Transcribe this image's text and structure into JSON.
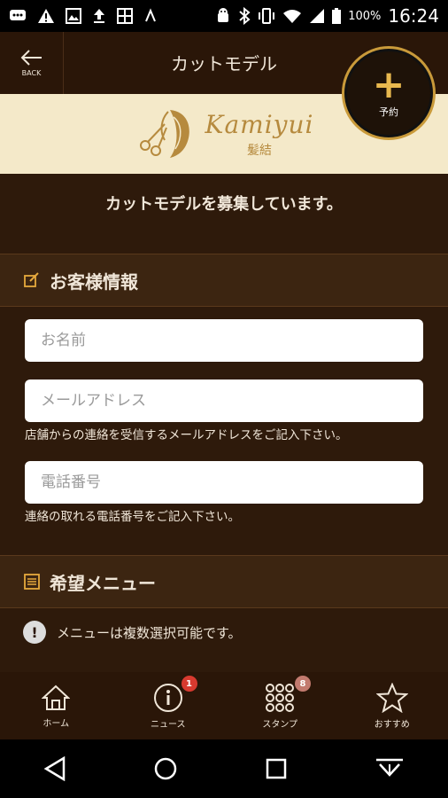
{
  "status_bar": {
    "battery_percent": "100%",
    "time": "16:24",
    "icons": [
      "message-icon",
      "warning-icon",
      "image-icon",
      "upload-icon",
      "grid-icon",
      "signal-icon",
      "android-icon",
      "bluetooth-icon",
      "vibrate-icon",
      "wifi-icon",
      "cell-signal-icon",
      "battery-icon"
    ]
  },
  "app_bar": {
    "back_label": "BACK",
    "title": "カットモデル"
  },
  "fab": {
    "label": "予約"
  },
  "banner": {
    "logo_text": "Kamiyui",
    "logo_kanji": "髪結"
  },
  "main": {
    "headline": "カットモデルを募集しています。",
    "customer_section": {
      "title": "お客様情報",
      "name_placeholder": "お名前",
      "email_placeholder": "メールアドレス",
      "email_help": "店舗からの連絡を受信するメールアドレスをご記入下さい。",
      "phone_placeholder": "電話番号",
      "phone_help": "連絡の取れる電話番号をご記入下さい。"
    },
    "menu_section": {
      "title": "希望メニュー",
      "notice": "メニューは複数選択可能です。"
    }
  },
  "bottom_nav": {
    "items": [
      {
        "label": "ホーム",
        "icon": "home-icon"
      },
      {
        "label": "ニュース",
        "icon": "info-icon",
        "badge": "1"
      },
      {
        "label": "スタンプ",
        "icon": "stamp-grid-icon",
        "badge": "8"
      },
      {
        "label": "おすすめ",
        "icon": "star-icon"
      }
    ]
  },
  "colors": {
    "background": "#2e1a0b",
    "accent_gold": "#c99a3a",
    "banner_cream": "#f4e9c9",
    "badge_red": "#d83a2f"
  }
}
